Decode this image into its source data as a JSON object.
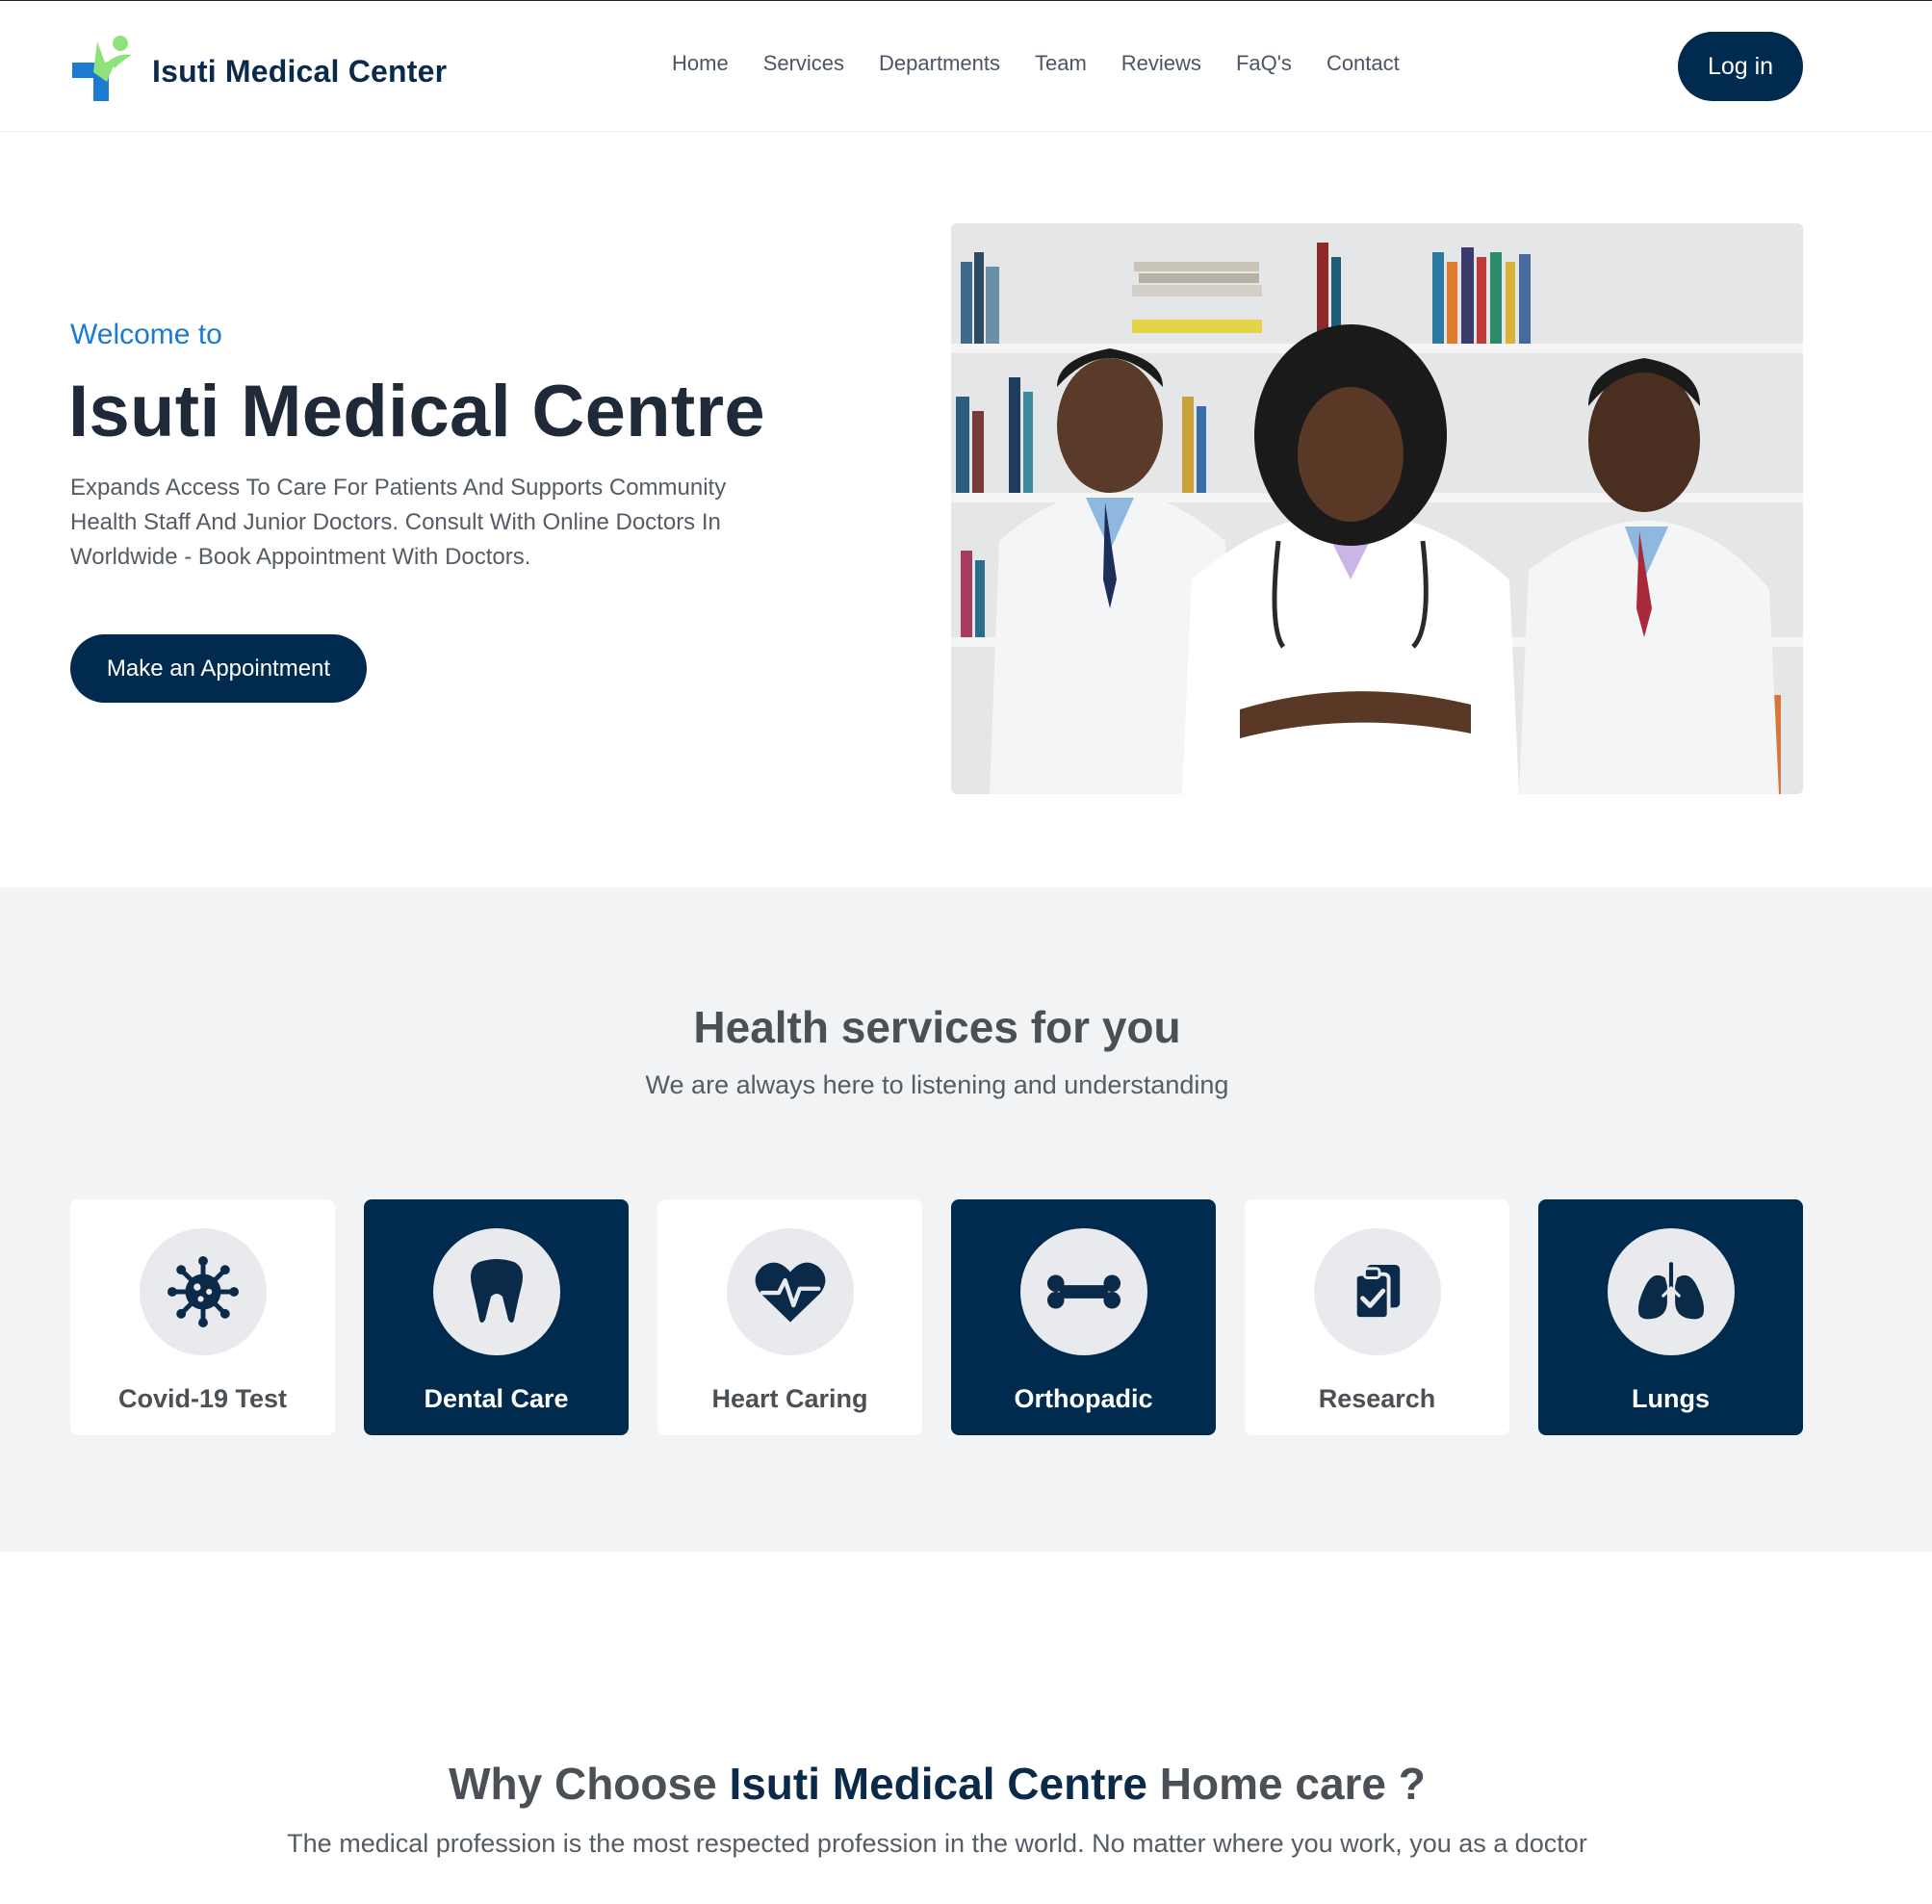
{
  "header": {
    "brand_name": "Isuti Medical Center",
    "nav": [
      "Home",
      "Services",
      "Departments",
      "Team",
      "Reviews",
      "FaQ's",
      "Contact"
    ],
    "login_label": "Log in"
  },
  "hero": {
    "welcome": "Welcome to",
    "title": "Isuti Medical Centre",
    "description": "Expands Access To Care For Patients And Supports Community Health Staff And Junior Doctors. Consult With Online Doctors In Worldwide - Book Appointment With Doctors.",
    "cta_label": "Make an Appointment"
  },
  "services": {
    "title": "Health services for you",
    "subtitle": "We are always here to listening and understanding",
    "items": [
      {
        "label": "Covid-19 Test",
        "icon": "virus-icon"
      },
      {
        "label": "Dental Care",
        "icon": "tooth-icon"
      },
      {
        "label": "Heart Caring",
        "icon": "heart-pulse-icon"
      },
      {
        "label": "Orthopadic",
        "icon": "bone-icon"
      },
      {
        "label": "Research",
        "icon": "clipboard-check-icon"
      },
      {
        "label": "Lungs",
        "icon": "lungs-icon"
      }
    ]
  },
  "why": {
    "title_prefix": "Why Choose ",
    "title_accent": "Isuti Medical Centre",
    "title_suffix": " Home care ?",
    "description": "The medical profession is the most respected profession in the world. No matter where you work, you as a doctor"
  },
  "colors": {
    "primary": "#002b4f",
    "accent_blue": "#1b7bd1",
    "logo_green": "#8fe27a",
    "section_bg": "#f2f3f5"
  }
}
